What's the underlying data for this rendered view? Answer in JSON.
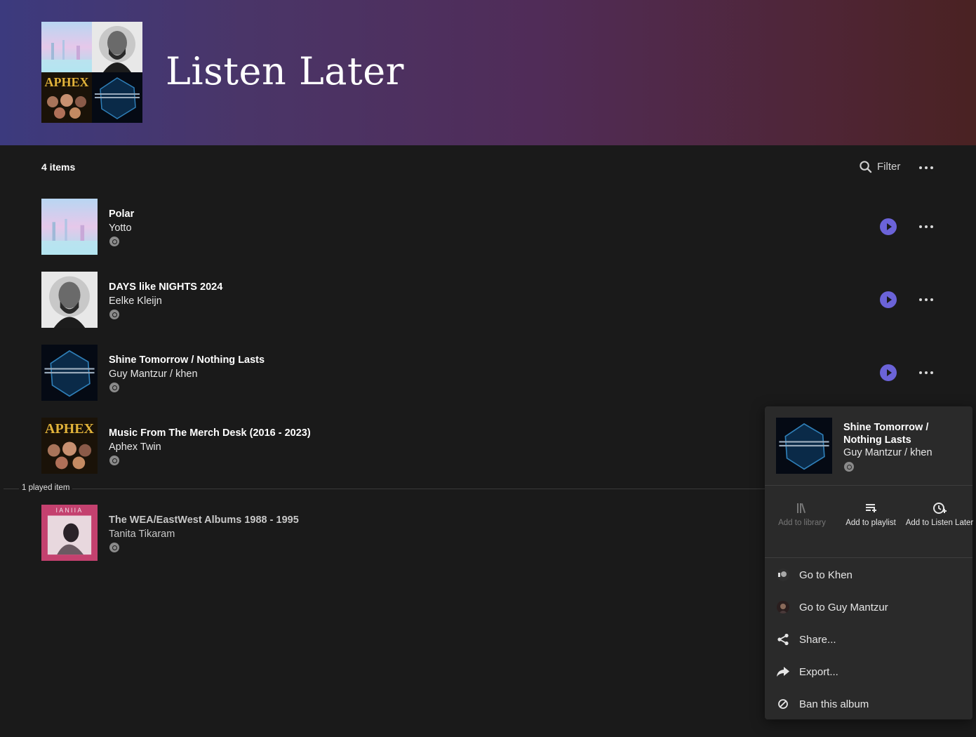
{
  "page": {
    "title": "Listen Later"
  },
  "toolbar": {
    "count": "4 items",
    "filter_label": "Filter"
  },
  "albums": [
    {
      "title": "Polar",
      "artist": "Yotto"
    },
    {
      "title": "DAYS like NIGHTS 2024",
      "artist": "Eelke Kleijn"
    },
    {
      "title": "Shine Tomorrow / Nothing Lasts",
      "artist": "Guy Mantzur / khen"
    },
    {
      "title": "Music From The Merch Desk (2016 - 2023)",
      "artist": "Aphex Twin"
    }
  ],
  "played": {
    "label": "1 played item",
    "items": [
      {
        "title": "The WEA/EastWest Albums 1988 - 1995",
        "artist": "Tanita Tikaram"
      }
    ]
  },
  "menu": {
    "title": "Shine Tomorrow / Nothing Lasts",
    "artist": "Guy Mantzur / khen",
    "actions": [
      {
        "label": "Add to library",
        "icon": "library-icon",
        "enabled": false
      },
      {
        "label": "Add to playlist",
        "icon": "playlist-add-icon",
        "enabled": true
      },
      {
        "label": "Add to Listen Later",
        "icon": "clock-add-icon",
        "enabled": true
      }
    ],
    "items": [
      {
        "label": "Go to Khen",
        "icon": "artist-avatar"
      },
      {
        "label": "Go to Guy Mantzur",
        "icon": "artist-avatar"
      },
      {
        "label": "Share...",
        "icon": "share-icon"
      },
      {
        "label": "Export...",
        "icon": "export-icon"
      },
      {
        "label": "Ban this album",
        "icon": "ban-icon"
      }
    ]
  },
  "colors": {
    "accent": "#6b63d8",
    "background": "#1a1a1a",
    "menu_bg": "#2a2a2a"
  }
}
